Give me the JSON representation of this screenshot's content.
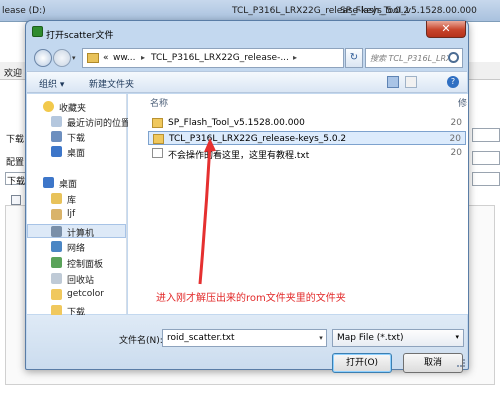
{
  "background": {
    "title_left": "lease (D:)",
    "title_path": "TCL_P316L_LRX22G_release-keys_5.0.2",
    "title_right": "SP_Flash_Tool_v5.1528.00.000",
    "welcome": "欢迎",
    "download_tab": "下载",
    "config": "配置",
    "download2": "下载"
  },
  "dialog": {
    "title": "打开scatter文件",
    "close": "✕"
  },
  "address": {
    "ellipsis": "«",
    "crumb1": "ww...",
    "crumb2": "TCL_P316L_LRX22G_release-...",
    "sep": "▸"
  },
  "search": {
    "placeholder": "搜索 TCL_P316L_LRX22G_rel..."
  },
  "toolbar": {
    "organize": "组织 ▾",
    "new_folder": "新建文件夹"
  },
  "nav": {
    "favorites": "收藏夹",
    "recent": "最近访问的位置",
    "downloads": "下载",
    "desktop_fav": "桌面",
    "desktop": "桌面",
    "library": "库",
    "user": "ljf",
    "computer": "计算机",
    "network": "网络",
    "control_panel": "控制面板",
    "recycle": "回收站",
    "getcolor": "getcolor",
    "download": "下载"
  },
  "files": {
    "col_name": "名称",
    "col_date": "修",
    "rows": [
      {
        "name": "SP_Flash_Tool_v5.1528.00.000",
        "type": "folder",
        "date": "20"
      },
      {
        "name": "TCL_P316L_LRX22G_release-keys_5.0.2",
        "type": "folder",
        "date": "20"
      },
      {
        "name": "不会操作的看这里，这里有教程.txt",
        "type": "doc",
        "date": "20"
      }
    ]
  },
  "annotation": "进入刚才解压出来的rom文件夹里的文件夹",
  "bottom": {
    "filename_label": "文件名(N):",
    "filename_value": "roid_scatter.txt",
    "filetype": "Map File (*.txt)",
    "open": "打开(O)",
    "cancel": "取消"
  }
}
